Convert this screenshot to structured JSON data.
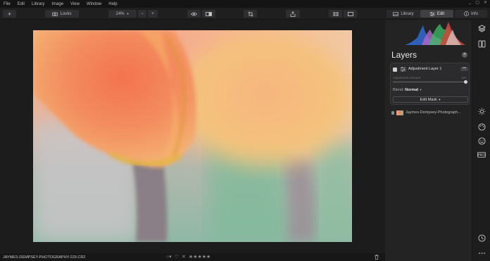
{
  "menu": [
    "File",
    "Edit",
    "Library",
    "Image",
    "View",
    "Window",
    "Help"
  ],
  "window_controls": [
    "_",
    "▢",
    "✕"
  ],
  "toolbar": {
    "add_label": "+",
    "looks_label": "Looks",
    "zoom_value": "24%",
    "zoom_out": "−",
    "zoom_in": "+",
    "library_tab": "Library",
    "edit_tab": "Edit",
    "info_tab": "Info"
  },
  "layers_panel": {
    "title": "Layers",
    "add_label": "+",
    "adjustment_layer": {
      "name": "Adjustment Layer 1",
      "more_label": "•••",
      "amount_label": "Adjustment Amount",
      "amount_value": "100",
      "amount": 1.0,
      "blend_label": "Blend:",
      "blend_value": "Normal",
      "mask_button": "Edit Mask"
    },
    "photo_layer": {
      "name": "Jaymes-Dempsey-Photograph..."
    }
  },
  "statusbar": {
    "filename": "JAYMES-DEMPSEY-PHOTOGRAPHY-229.CR2",
    "stars": 0
  },
  "colors": {
    "accent_histogram_blue": "#2f6bd4",
    "accent_histogram_red": "#d0473d",
    "accent_histogram_green": "#3bbf63"
  },
  "icons": [
    "plus-icon",
    "looks-icon",
    "eye-icon",
    "compare-icon",
    "crop-icon",
    "export-icon",
    "grid-view-icon",
    "single-view-icon",
    "library-icon",
    "edit-sliders-icon",
    "info-icon",
    "layers-icon",
    "presets-icon",
    "sun-icon",
    "palette-icon",
    "face-icon",
    "pro-icon",
    "history-icon",
    "more-icon",
    "trash-icon"
  ]
}
